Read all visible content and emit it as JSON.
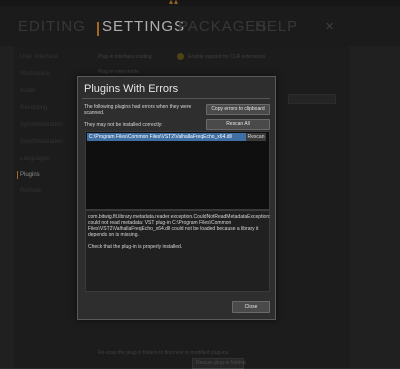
{
  "background": {
    "tabs": [
      "EDITING",
      "SETTINGS",
      "PACKAGES",
      "HELP"
    ],
    "active_tab": "SETTINGS",
    "sidebar": [
      "User Interface",
      "Workspace",
      "Audio",
      "Recording",
      "Synchronization",
      "Synchronization",
      "Languages",
      "Plugins",
      "Remote"
    ],
    "active_sidebar": "Plugins",
    "plugin_interface_label": "Plug-in interface loading",
    "plugin_interface_option": "Enable support for CLR extensions",
    "plugin_view_mode_label": "Plug-in view mode",
    "rescan_hint": "Re-scan the plug-in folders to find new or modified plug-ins.",
    "rescan_button": "Rescan plug-in folders"
  },
  "dialog": {
    "title": "Plugins With Errors",
    "intro": "The following plugins had errors when they were scanned.",
    "subtitle": "They may not be installed correctly:",
    "copy_button": "Copy errors to clipboard",
    "rescan_all_button": "Rescan All",
    "plugins": [
      {
        "path": "C:\\Program Files\\Common Files\\VST2\\ValhallaFreqEcho_x64.dll",
        "rescan_label": "Rescan"
      }
    ],
    "error_message": "com.bitwig.flt.library.metadata.reader.exception.CouldNotReadMetadataException: could not read metadata: VST plug-in C:\\Program Files\\Common Files\\VST2\\ValhallaFreqEcho_x64.dll could not be loaded because a library it depends on is missing.",
    "error_hint": "Check that the plug-in is properly installed.",
    "close_button": "Close"
  },
  "colors": {
    "accent": "#e08a2a",
    "selection": "#3f6fa3"
  }
}
